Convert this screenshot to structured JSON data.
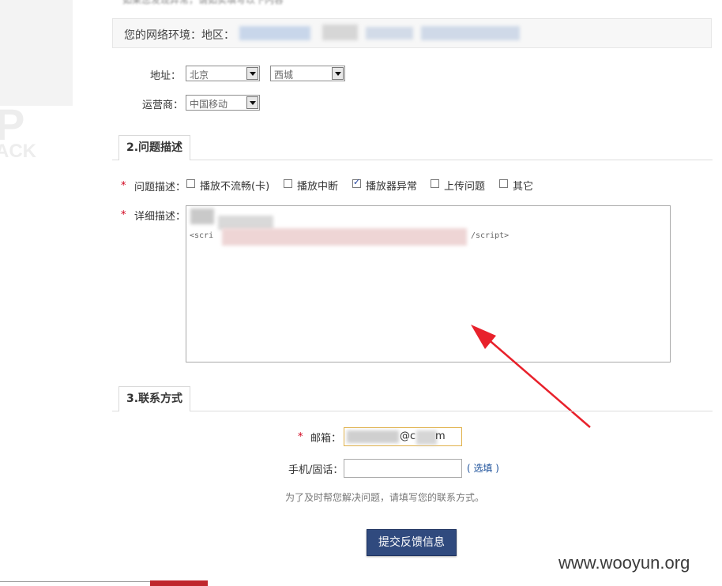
{
  "network": {
    "label": "您的网络环境：地区："
  },
  "address": {
    "label": "地址：",
    "province": "北京",
    "district": "西城"
  },
  "carrier": {
    "label": "运营商：",
    "value": "中国移动"
  },
  "section2": {
    "title": "2.问题描述",
    "required_mark": "*",
    "issue_label": "问题描述：",
    "options": [
      {
        "label": "播放不流畅(卡)",
        "checked": false
      },
      {
        "label": "播放中断",
        "checked": false
      },
      {
        "label": "播放器异常",
        "checked": true
      },
      {
        "label": "上传问题",
        "checked": false
      },
      {
        "label": "其它",
        "checked": false
      }
    ],
    "detail_label": "详细描述：",
    "detail_line1": "<scri",
    "detail_line2": "/script>"
  },
  "section3": {
    "title": "3.联系方式",
    "email_label": "邮箱：",
    "email_value": "@c",
    "email_suffix": "m",
    "phone_label": "手机/固话：",
    "optional": "( 选填 )",
    "note": "为了及时帮您解决问题，请填写您的联系方式。"
  },
  "submit_label": "提交反馈信息",
  "watermark": "www.wooyun.org",
  "colors": {
    "accent": "#304a7e",
    "required": "#d0021b",
    "annotation_arrow": "#e8212b"
  }
}
